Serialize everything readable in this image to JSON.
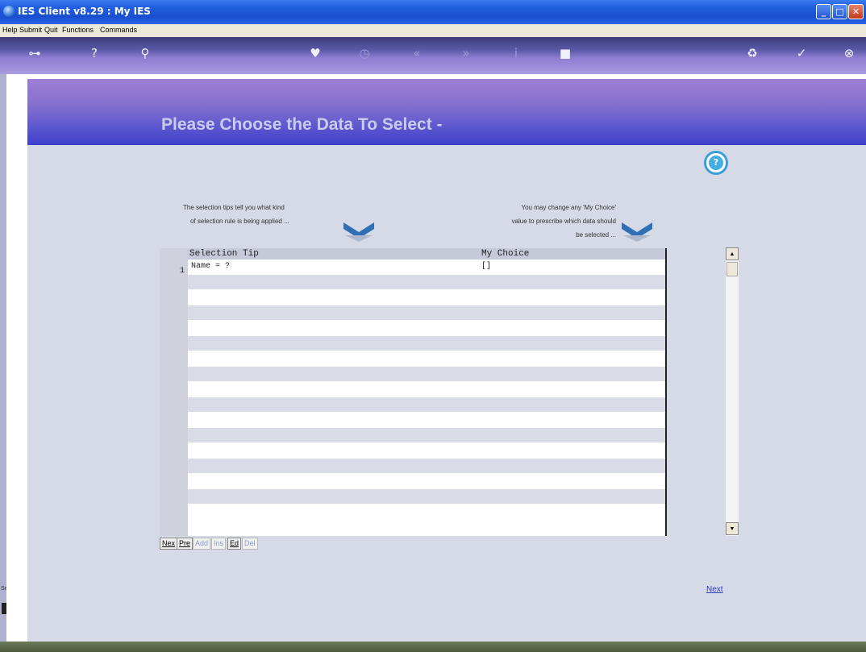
{
  "window": {
    "title": "IES Client v8.29 : My IES",
    "controls": {
      "minimize": "_",
      "maximize": "□",
      "close": "✕"
    }
  },
  "menu": {
    "items": [
      "Help",
      "Submit",
      "Quit",
      "Functions",
      "Commands"
    ]
  },
  "toolbar": {
    "icons": [
      "key-icon",
      "help-icon",
      "search-icon",
      "heart-icon",
      "clock-icon",
      "rewind-icon",
      "fast-forward-icon",
      "info-icon",
      "stop-icon",
      "recycle-icon",
      "check-icon",
      "close-icon"
    ]
  },
  "page": {
    "title": "Please Choose the Data To Select -",
    "tip_left_line1": "The selection tips tell you what kind",
    "tip_left_line2": "of selection rule is being applied ...",
    "tip_right_line1": "You may change any 'My Choice'",
    "tip_right_line2": "value to prescribe which data should",
    "tip_right_line3": "be selected ..."
  },
  "grid": {
    "headers": {
      "tip": "Selection Tip",
      "choice": "My Choice"
    },
    "rows": [
      {
        "num": "1",
        "tip": "Name = ?",
        "choice": "[]"
      }
    ],
    "empty_rows": 16
  },
  "buttons": {
    "nex": "Nex",
    "pre": "Pre",
    "add": "Add",
    "ins": "Ins",
    "ed": "Ed",
    "del": "Del",
    "next": "Next"
  },
  "status": {
    "label": "Ser"
  },
  "colors": {
    "banner_top": "#9e7fd4",
    "banner_bottom": "#3d3fcb",
    "panel_bg": "#d6d9e6",
    "title_text": "#c9cbea",
    "arrow": "#2f6fb4"
  }
}
